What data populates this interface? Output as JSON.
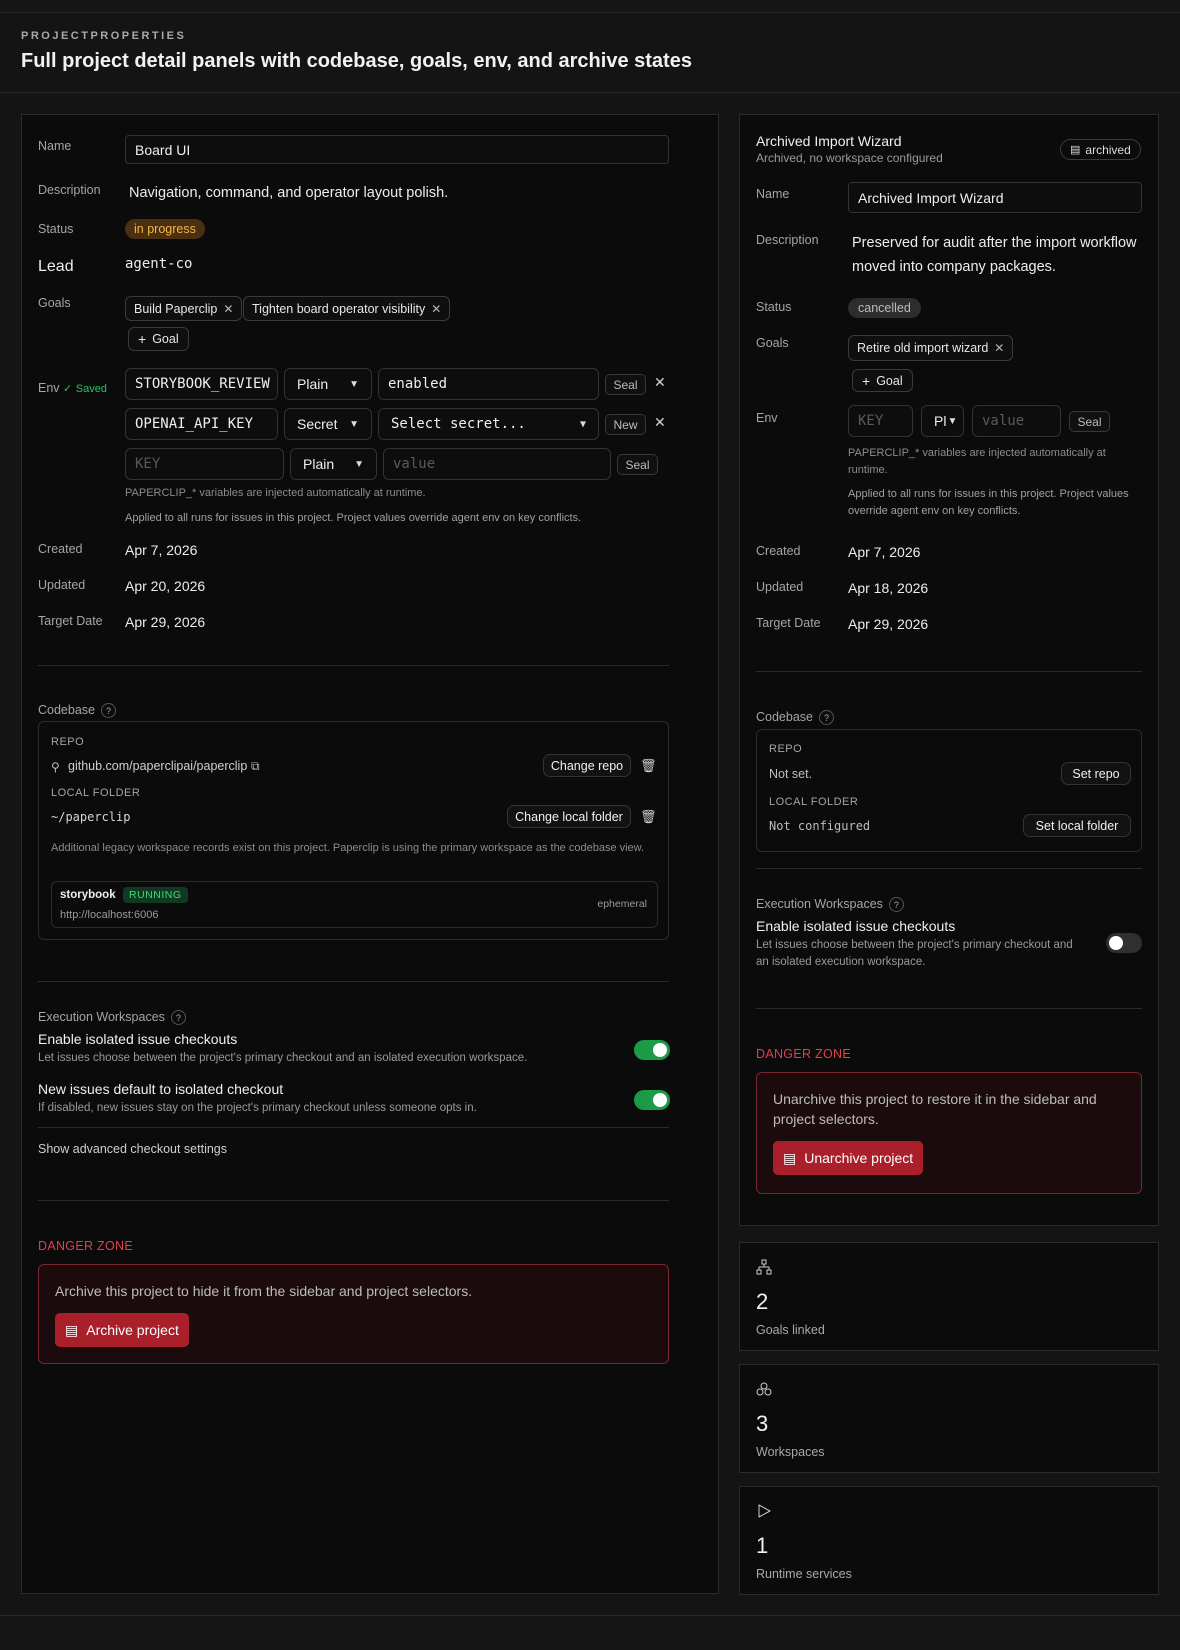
{
  "header": {
    "eyebrow": "PROJECTPROPERTIES",
    "title": "Full project detail panels with codebase, goals, env, and archive states"
  },
  "left": {
    "labels": {
      "name": "Name",
      "description": "Description",
      "status": "Status",
      "lead": "Lead",
      "goals": "Goals",
      "env": "Env",
      "created": "Created",
      "updated": "Updated",
      "target": "Target Date"
    },
    "name_value": "Board UI",
    "description": "Navigation, command, and operator layout polish.",
    "status": "in progress",
    "lead": "agent-co",
    "goals": [
      "Build Paperclip",
      "Tighten board operator visibility"
    ],
    "add_goal": "Goal",
    "env_saved": "Saved",
    "env_rows": [
      {
        "key": "STORYBOOK_REVIEW",
        "type": "Plain",
        "value": "enabled",
        "action": "Seal"
      },
      {
        "key": "OPENAI_API_KEY",
        "type": "Secret",
        "value": "Select secret...",
        "action": "New"
      },
      {
        "key": "KEY",
        "type": "Plain",
        "value": "value",
        "action": "Seal"
      }
    ],
    "env_hint_1": "PAPERCLIP_* variables are injected automatically at runtime.",
    "env_hint_2": "Applied to all runs for issues in this project. Project values override agent env on key conflicts.",
    "created": "Apr 7, 2026",
    "updated": "Apr 20, 2026",
    "target": "Apr 29, 2026",
    "codebase": {
      "title": "Codebase",
      "repo_label": "REPO",
      "repo": "github.com/paperclipai/paperclip",
      "change_repo": "Change repo",
      "folder_label": "LOCAL FOLDER",
      "folder": "~/paperclip",
      "change_folder": "Change local folder",
      "legacy_note": "Additional legacy workspace records exist on this project. Paperclip is using the primary workspace as the codebase view.",
      "service_name": "storybook",
      "service_status": "RUNNING",
      "service_url": "http://localhost:6006",
      "service_kind": "ephemeral"
    },
    "execution": {
      "title": "Execution Workspaces",
      "opt1_title": "Enable isolated issue checkouts",
      "opt1_desc": "Let issues choose between the project's primary checkout and an isolated execution workspace.",
      "opt2_title": "New issues default to isolated checkout",
      "opt2_desc": "If disabled, new issues stay on the project's primary checkout unless someone opts in.",
      "advanced": "Show advanced checkout settings"
    },
    "danger": {
      "title": "DANGER ZONE",
      "text": "Archive this project to hide it from the sidebar and project selectors.",
      "button": "Archive project"
    }
  },
  "right": {
    "title": "Archived Import Wizard",
    "subtitle": "Archived, no workspace configured",
    "badge": "archived",
    "labels": {
      "name": "Name",
      "description": "Description",
      "status": "Status",
      "goals": "Goals",
      "env": "Env",
      "created": "Created",
      "updated": "Updated",
      "target": "Target Date"
    },
    "name_value": "Archived Import Wizard",
    "description": "Preserved for audit after the import workflow moved into company packages.",
    "status": "cancelled",
    "goals": [
      "Retire old import wizard"
    ],
    "add_goal": "Goal",
    "env_key_ph": "KEY",
    "env_type": "Pl",
    "env_value_ph": "value",
    "env_action": "Seal",
    "env_hint_1": "PAPERCLIP_* variables are injected automatically at runtime.",
    "env_hint_2": "Applied to all runs for issues in this project. Project values override agent env on key conflicts.",
    "created": "Apr 7, 2026",
    "updated": "Apr 18, 2026",
    "target": "Apr 29, 2026",
    "codebase": {
      "title": "Codebase",
      "repo_label": "REPO",
      "repo": "Not set.",
      "set_repo": "Set repo",
      "folder_label": "LOCAL FOLDER",
      "folder": "Not configured",
      "set_folder": "Set local folder"
    },
    "execution": {
      "title": "Execution Workspaces",
      "opt1_title": "Enable isolated issue checkouts",
      "opt1_desc": "Let issues choose between the project's primary checkout and an isolated execution workspace."
    },
    "danger": {
      "title": "DANGER ZONE",
      "text": "Unarchive this project to restore it in the sidebar and project selectors.",
      "button": "Unarchive project"
    }
  },
  "stats": [
    {
      "icon": "hierarchy-icon",
      "value": "2",
      "label": "Goals linked"
    },
    {
      "icon": "cubes-icon",
      "value": "3",
      "label": "Workspaces"
    },
    {
      "icon": "play-icon",
      "value": "1",
      "label": "Runtime services"
    }
  ],
  "toggles": {
    "left_isolated": true,
    "left_default_isolated": true,
    "right_isolated": false
  },
  "colors": {
    "accent_green": "#1b9b45",
    "danger_red": "#a91f2a",
    "status_in_progress": "#f5b642"
  }
}
